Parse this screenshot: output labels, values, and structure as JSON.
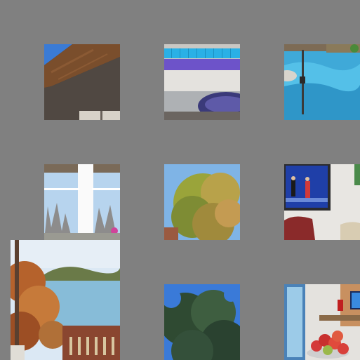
{
  "background_color": "#808080",
  "tiles": [
    {
      "id": "roof-eave",
      "interactable": true
    },
    {
      "id": "pool-tiles",
      "interactable": true
    },
    {
      "id": "poolside-umbrella",
      "interactable": true
    },
    {
      "id": "window-view",
      "interactable": true
    },
    {
      "id": "autumn-tree",
      "interactable": true
    },
    {
      "id": "tv-living-room",
      "interactable": true
    },
    {
      "id": "lake-deck",
      "interactable": true
    },
    {
      "id": "green-foliage",
      "interactable": true
    },
    {
      "id": "kitchen-apples",
      "interactable": true
    }
  ]
}
